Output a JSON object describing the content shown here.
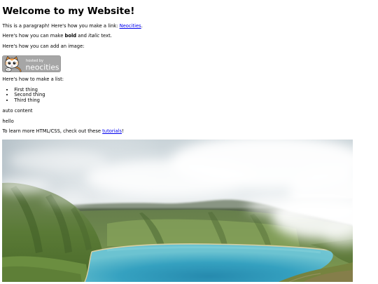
{
  "page": {
    "background": "#ffffff",
    "text_color": "#000000",
    "link_color": "#0000ee"
  },
  "header": {
    "title": "Welcome to my Website!"
  },
  "content": {
    "link_paragraph": {
      "before": "This is a paragraph! Here's how you make a link: ",
      "link": "Neocities",
      "after": "."
    },
    "format_paragraph": {
      "before": "Here's how you can make ",
      "bold": "bold",
      "middle": " and ",
      "italic": "italic",
      "after": " text."
    },
    "image_paragraph": "Here's how you can add an image:",
    "badge": {
      "icon": "neocities-cat-icon",
      "line1": "hosted by",
      "line2": "neocities"
    },
    "list_paragraph": "Here's how to make a list:",
    "list_items": [
      "First thing",
      "Second thing",
      "Third thing"
    ],
    "auto_paragraph": "auto content",
    "hello_paragraph": "hello",
    "tutorials_paragraph": {
      "before": "To learn more HTML/CSS, check out these ",
      "link": "tutorials",
      "after": "!"
    }
  }
}
